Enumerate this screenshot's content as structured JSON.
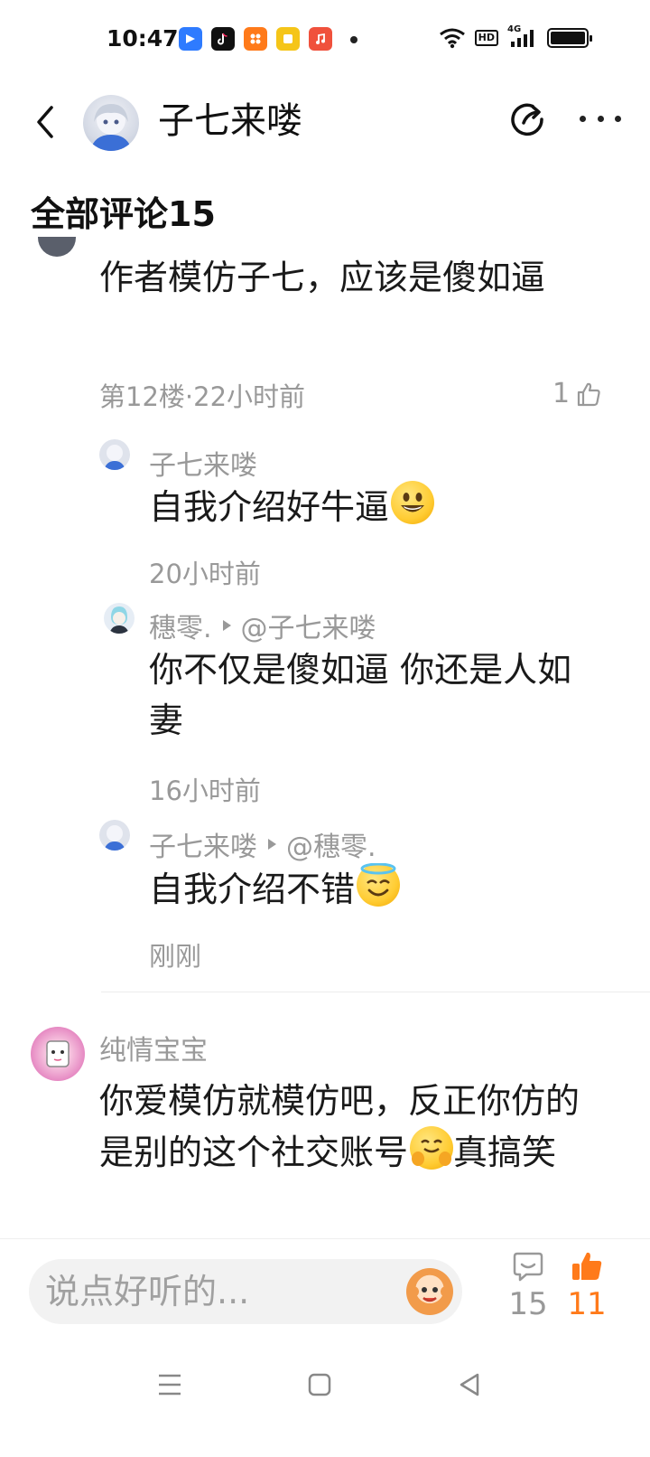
{
  "status_bar": {
    "time": "10:47",
    "hd_label": "HD",
    "network_label": "4G",
    "app_icons": [
      {
        "name": "feishu-icon",
        "color": "#2e7bff"
      },
      {
        "name": "tiktok-icon",
        "color": "#111111"
      },
      {
        "name": "app-grid-icon",
        "color": "#ff7a1a"
      },
      {
        "name": "notes-icon",
        "color": "#f5c518"
      },
      {
        "name": "music-icon",
        "color": "#f0513c"
      }
    ]
  },
  "header": {
    "title": "子七来喽"
  },
  "section_title": "全部评论15",
  "comments": {
    "top": {
      "text": "作者模仿子七，应该是傻如逼",
      "meta": "第12楼·22小时前",
      "likes": "1"
    },
    "reply1": {
      "name": "子七来喽",
      "text": "自我介绍好牛逼",
      "time": "20小时前"
    },
    "reply2": {
      "name": "穗零.",
      "mention": "@子七来喽",
      "text": "你不仅是傻如逼 你还是人如妻",
      "time": "16小时前"
    },
    "reply3": {
      "name": "子七来喽",
      "mention": "@穗零.",
      "text": "自我介绍不错",
      "time": "刚刚"
    },
    "next": {
      "name": "纯情宝宝",
      "text": "你爱模仿就模仿吧，反正你仿的是别的这个社交账号",
      "text_end": "真搞笑"
    }
  },
  "bottom_bar": {
    "placeholder": "说点好听的...",
    "comment_count": "15",
    "like_count": "11"
  },
  "colors": {
    "accent": "#ff7a1a",
    "meta_text": "#999999",
    "body_text": "#1a1a1a"
  }
}
